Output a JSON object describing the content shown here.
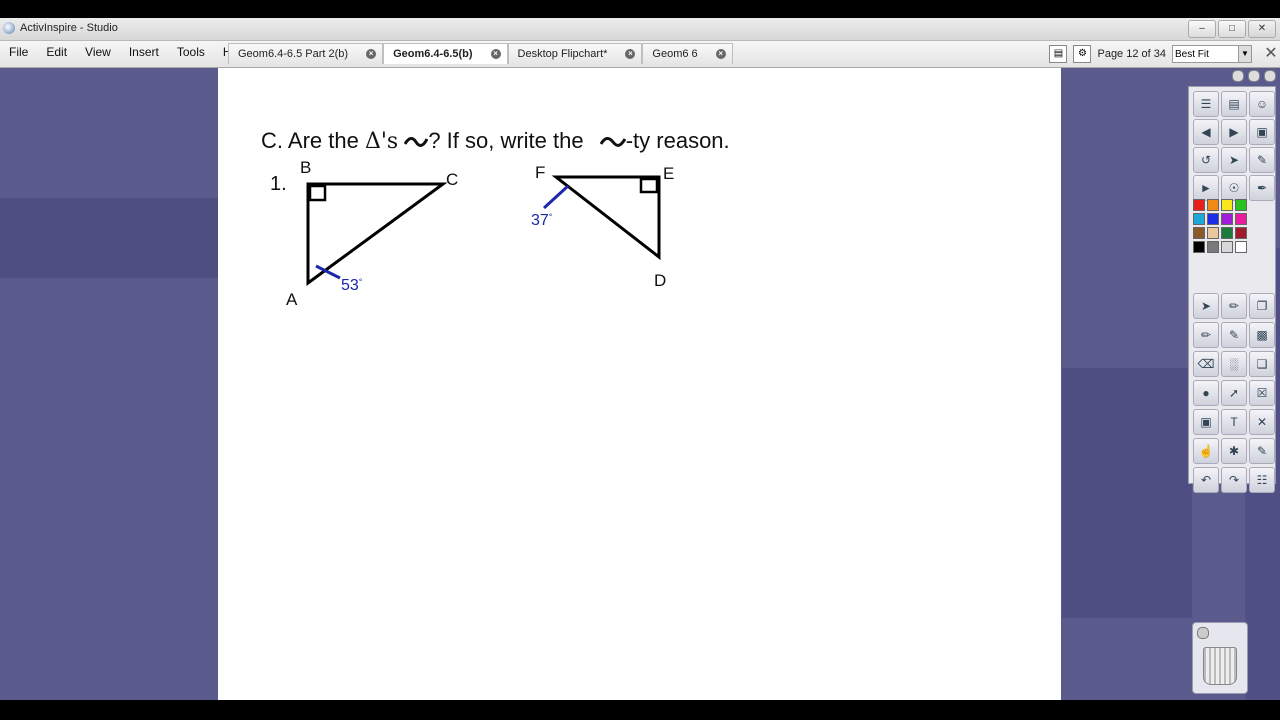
{
  "window": {
    "title": "ActivInspire - Studio"
  },
  "menu": [
    "File",
    "Edit",
    "View",
    "Insert",
    "Tools",
    "Help"
  ],
  "doc_tabs": [
    {
      "label": "Geom6.4-6.5 Part 2(b)",
      "active": false
    },
    {
      "label": "Geom6.4-6.5(b)",
      "active": true
    },
    {
      "label": "Desktop Flipchart*",
      "active": false
    },
    {
      "label": "Geom6 6",
      "active": false
    }
  ],
  "page_indicator": "Page 12 of 34",
  "zoom": "Best Fit",
  "content": {
    "heading_pre": "C. Are the ",
    "heading_delta": "Δ's",
    "heading_mid": "? If so, write  the ",
    "heading_post": "-ty reason.",
    "problem_number": "1.",
    "tri1": {
      "vertex_b": "B",
      "vertex_c": "C",
      "vertex_a": "A",
      "angle": "53"
    },
    "tri2": {
      "vertex_f": "F",
      "vertex_e": "E",
      "vertex_d": "D",
      "angle": "37"
    },
    "degree_symbol": "°"
  },
  "colors": {
    "workspace": "#5a5a8c",
    "angle_blue": "#1c28a8"
  }
}
